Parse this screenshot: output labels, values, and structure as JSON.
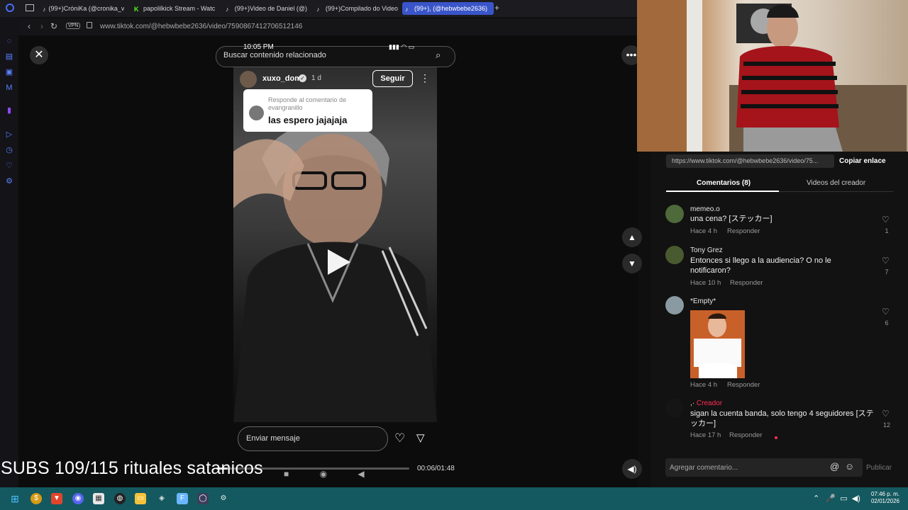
{
  "browser": {
    "tabs": [
      {
        "label": "(99+)CróniKa (@cronika_v"
      },
      {
        "label": "papolilkick Stream - Watc"
      },
      {
        "label": "(99+)Video de Daniel (@)"
      },
      {
        "label": "(99+)Compilado do Video"
      },
      {
        "label": "(99+), (@hebwbebe2636)"
      }
    ],
    "vpn_label": "VPN",
    "url": "www.tiktok.com/@hebwbebe2636/video/7590867412706512146"
  },
  "icons": {
    "close": "close-icon",
    "search": "search-icon",
    "more": "more-icon",
    "heart": "heart-icon",
    "share": "share-icon",
    "play": "play-icon"
  },
  "search": {
    "placeholder": "Buscar contenido relacionado"
  },
  "video": {
    "status_time": "10:05 PM",
    "username": "xuxo_dom",
    "time_ago": "1 d",
    "follow_label": "Seguir",
    "reply_label": "Responde al comentario de evangranillo",
    "reply_text": "las espero jajajaja",
    "message_placeholder": "Enviar mensaje",
    "progress_time": "00:06/01:48",
    "progress_fraction": 0.06
  },
  "overlay": {
    "subs_text": "SUBS 109/115 rituales satanicos"
  },
  "panel": {
    "link_text": "https://www.tiktok.com/@hebwbebe2636/video/75...",
    "copy_label": "Copiar enlace",
    "tab_comments": "Comentarios (8)",
    "tab_videos": "Videos del creador",
    "comments": [
      {
        "name": "memeo.o",
        "text": "una cena? [ステッカー]",
        "time": "Hace 4 h",
        "reply": "Responder",
        "likes": "1"
      },
      {
        "name": "Tony Grez",
        "text": "Entonces si llego a la audiencia? O no le notificaron?",
        "time": "Hace 10 h",
        "reply": "Responder",
        "likes": "7"
      },
      {
        "name": "*Empty*",
        "text": "",
        "time": "Hace 4 h",
        "reply": "Responder",
        "likes": "6"
      },
      {
        "name": ",·",
        "creator_badge": "Creador",
        "text": "sigan la cuenta banda, solo tengo 4 seguidores [ステッカー]",
        "time": "Hace 17 h",
        "reply": "Responder",
        "likes": "12"
      }
    ],
    "add_comment_placeholder": "Agregar comentario...",
    "publish_label": "Publicar"
  },
  "taskbar": {
    "time": "07:46 p. m.",
    "date": "02/01/2026"
  },
  "colors": {
    "taskbar": "#14595f",
    "accent": "#3a55c9",
    "creator": "#fe2c55"
  }
}
